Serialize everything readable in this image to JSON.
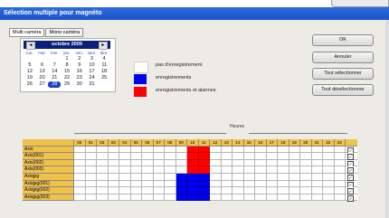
{
  "window": {
    "title": "Sélection multiple pour magnéto"
  },
  "tabs": [
    "Multi caméra",
    "Mono caméra"
  ],
  "calendar": {
    "month_label": "octobre 2009",
    "prev_glyph": "◄",
    "next_glyph": "►",
    "dow": [
      "lun.",
      "mar.",
      "mer.",
      "jeu.",
      "ven.",
      "sam.",
      "dim."
    ],
    "weeks": [
      [
        "",
        "",
        "",
        "1",
        "2",
        "3",
        "4"
      ],
      [
        "5",
        "6",
        "7",
        "8",
        "9",
        "10",
        "11"
      ],
      [
        "12",
        "13",
        "14",
        "15",
        "16",
        "17",
        "18"
      ],
      [
        "19",
        "20",
        "21",
        "22",
        "23",
        "24",
        "25"
      ],
      [
        "26",
        "27",
        "28",
        "29",
        "30",
        "31",
        ""
      ]
    ],
    "selected_day": "28"
  },
  "legend": {
    "none_label": "pas d'enregistrement",
    "rec_label": "enregistrements",
    "alarm_label": "enregistrements et alarmes",
    "colors": {
      "none": "#ffffff",
      "rec": "#0000ee",
      "alarm": "#ff0000"
    }
  },
  "buttons": {
    "ok": "OK",
    "cancel": "Annuler",
    "select_all": "Tout sélectionner",
    "deselect_all": "Tout désélectionner"
  },
  "grid": {
    "hours_label": "Heures",
    "hours": [
      "00",
      "01",
      "02",
      "03",
      "04",
      "05",
      "06",
      "07",
      "08",
      "09",
      "10",
      "11",
      "12",
      "13",
      "14",
      "15",
      "16",
      "17",
      "18",
      "19",
      "20",
      "21",
      "22",
      "23"
    ],
    "rows": [
      {
        "name": "Axis",
        "red": [
          10,
          11
        ],
        "blue": [],
        "checked": true
      },
      {
        "name": "Axis(001)",
        "red": [
          10,
          11
        ],
        "blue": [],
        "checked": true
      },
      {
        "name": "Axis(002)",
        "red": [
          10,
          11
        ],
        "blue": [],
        "checked": true
      },
      {
        "name": "Axis(003)",
        "red": [
          10,
          11
        ],
        "blue": [],
        "checked": true
      },
      {
        "name": "Axisjpg",
        "red": [],
        "blue": [
          9,
          10,
          11
        ],
        "checked": true
      },
      {
        "name": "Axisjpg(001)",
        "red": [],
        "blue": [
          9,
          10,
          11
        ],
        "checked": true
      },
      {
        "name": "Axisjpg(002)",
        "red": [],
        "blue": [
          9,
          10,
          11
        ],
        "checked": true
      },
      {
        "name": "Axisjpg(003)",
        "red": [],
        "blue": [
          9,
          10,
          11
        ],
        "checked": true
      }
    ],
    "check_glyph": "✓"
  }
}
